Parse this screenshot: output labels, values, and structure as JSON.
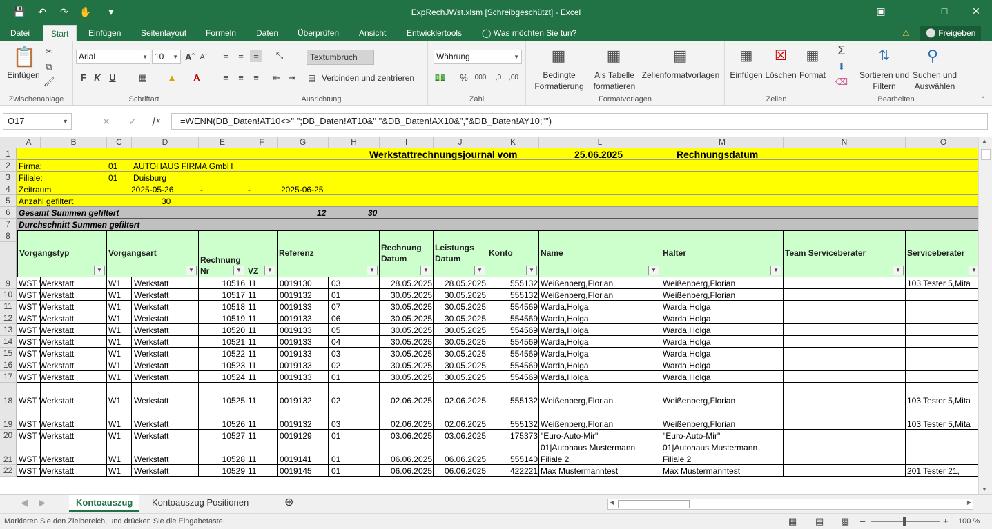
{
  "window": {
    "title": "ExpRechJWst.xlsm  [Schreibgeschützt] - Excel"
  },
  "ribbon_tabs": [
    "Datei",
    "Start",
    "Einfügen",
    "Seitenlayout",
    "Formeln",
    "Daten",
    "Überprüfen",
    "Ansicht",
    "Entwicklertools"
  ],
  "tell_me": "Was möchten Sie tun?",
  "share_label": "Freigeben",
  "ribbon": {
    "clipboard": {
      "paste": "Einfügen",
      "label": "Zwischenablage"
    },
    "font": {
      "name": "Arial",
      "size": "10",
      "label": "Schriftart",
      "bold": "F",
      "italic": "K",
      "underline": "U"
    },
    "align": {
      "wrap": "Textumbruch",
      "merge": "Verbinden und zentrieren",
      "label": "Ausrichtung"
    },
    "number": {
      "format": "Währung",
      "label": "Zahl"
    },
    "styles": {
      "cond1": "Bedingte",
      "cond2": "Formatierung",
      "table1": "Als Tabelle",
      "table2": "formatieren",
      "cell": "Zellenformatvorlagen",
      "label": "Formatvorlagen"
    },
    "cells": {
      "insert": "Einfügen",
      "delete": "Löschen",
      "format": "Format",
      "label": "Zellen"
    },
    "edit": {
      "sort1": "Sortieren und",
      "sort2": "Filtern",
      "find1": "Suchen und",
      "find2": "Auswählen",
      "label": "Bearbeiten"
    }
  },
  "formula_bar": {
    "name_box": "O17",
    "formula": "=WENN(DB_Daten!AT10<>\" \";DB_Daten!AT10&\" \"&DB_Daten!AX10&\",\"&DB_Daten!AY10;\"\")"
  },
  "columns": [
    "A",
    "B",
    "C",
    "D",
    "E",
    "F",
    "G",
    "H",
    "I",
    "J",
    "K",
    "L",
    "M",
    "N",
    "O"
  ],
  "sheet": {
    "row1": {
      "title": "Werkstattrechnungsjournal vom",
      "date": "25.06.2025",
      "label": "Rechnungsdatum"
    },
    "row2": {
      "label": "Firma:",
      "code": "01",
      "value": "AUTOHAUS FIRMA GmbH"
    },
    "row3": {
      "label": "Filiale:",
      "code": "01",
      "value": "Duisburg"
    },
    "row4": {
      "label": "Zeitraum",
      "from": "2025-05-26",
      "dash1": "-",
      "dash2": "-",
      "to": "2025-06-25"
    },
    "row5": {
      "label": "Anzahl gefiltert",
      "value": "30"
    },
    "row6": {
      "label": "Gesamt Summen gefiltert",
      "v1": "12",
      "v2": "30"
    },
    "row7": {
      "label": "Durchschnitt Summen gefiltert"
    },
    "headers": {
      "a": "Vorgangstyp",
      "c": "Vorgangsart",
      "e1": "Rechnung",
      "e2": "Nr",
      "f": "VZ",
      "g": "Referenz",
      "i1": "Rechnung",
      "i2": "Datum",
      "j1": "Leistungs",
      "j2": "Datum",
      "k": "Konto",
      "l": "Name",
      "m": "Halter",
      "n": "Team Serviceberater",
      "o": "Serviceberater"
    },
    "rows": [
      {
        "n": "9",
        "a": "WST Werkstatt",
        "c": "W1",
        "d": "Werkstatt",
        "e": "10516",
        "f": "11",
        "g": "0019130",
        "h": "03",
        "i": "28.05.2025",
        "j": "28.05.2025",
        "k": "555132",
        "l": "Weißenberg,Florian",
        "m": "Weißenberg,Florian",
        "o": "103 Tester 5,Mita"
      },
      {
        "n": "10",
        "a": "WST Werkstatt",
        "c": "W1",
        "d": "Werkstatt",
        "e": "10517",
        "f": "11",
        "g": "0019132",
        "h": "01",
        "i": "30.05.2025",
        "j": "30.05.2025",
        "k": "555132",
        "l": "Weißenberg,Florian",
        "m": "Weißenberg,Florian",
        "o": ""
      },
      {
        "n": "11",
        "a": "WST Werkstatt",
        "c": "W1",
        "d": "Werkstatt",
        "e": "10518",
        "f": "11",
        "g": "0019133",
        "h": "07",
        "i": "30.05.2025",
        "j": "30.05.2025",
        "k": "554569",
        "l": " Warda,Holga",
        "m": " Warda,Holga",
        "o": ""
      },
      {
        "n": "12",
        "a": "WST Werkstatt",
        "c": "W1",
        "d": "Werkstatt",
        "e": "10519",
        "f": "11",
        "g": "0019133",
        "h": "06",
        "i": "30.05.2025",
        "j": "30.05.2025",
        "k": "554569",
        "l": " Warda,Holga",
        "m": " Warda,Holga",
        "o": ""
      },
      {
        "n": "13",
        "a": "WST Werkstatt",
        "c": "W1",
        "d": "Werkstatt",
        "e": "10520",
        "f": "11",
        "g": "0019133",
        "h": "05",
        "i": "30.05.2025",
        "j": "30.05.2025",
        "k": "554569",
        "l": " Warda,Holga",
        "m": " Warda,Holga",
        "o": ""
      },
      {
        "n": "14",
        "a": "WST Werkstatt",
        "c": "W1",
        "d": "Werkstatt",
        "e": "10521",
        "f": "11",
        "g": "0019133",
        "h": "04",
        "i": "30.05.2025",
        "j": "30.05.2025",
        "k": "554569",
        "l": " Warda,Holga",
        "m": " Warda,Holga",
        "o": ""
      },
      {
        "n": "15",
        "a": "WST Werkstatt",
        "c": "W1",
        "d": "Werkstatt",
        "e": "10522",
        "f": "11",
        "g": "0019133",
        "h": "03",
        "i": "30.05.2025",
        "j": "30.05.2025",
        "k": "554569",
        "l": " Warda,Holga",
        "m": " Warda,Holga",
        "o": ""
      },
      {
        "n": "16",
        "a": "WST Werkstatt",
        "c": "W1",
        "d": "Werkstatt",
        "e": "10523",
        "f": "11",
        "g": "0019133",
        "h": "02",
        "i": "30.05.2025",
        "j": "30.05.2025",
        "k": "554569",
        "l": " Warda,Holga",
        "m": " Warda,Holga",
        "o": ""
      },
      {
        "n": "17",
        "a": "WST Werkstatt",
        "c": "W1",
        "d": "Werkstatt",
        "e": "10524",
        "f": "11",
        "g": "0019133",
        "h": "01",
        "i": "30.05.2025",
        "j": "30.05.2025",
        "k": "554569",
        "l": " Warda,Holga",
        "m": " Warda,Holga",
        "o": ""
      },
      {
        "n": "18",
        "a": "WST Werkstatt",
        "c": "W1",
        "d": "Werkstatt",
        "e": "10525",
        "f": "11",
        "g": "0019132",
        "h": "02",
        "i": "02.06.2025",
        "j": "02.06.2025",
        "k": "555132",
        "l": "Weißenberg,Florian",
        "m": "Weißenberg,Florian",
        "o": "103 Tester 5,Mita"
      },
      {
        "n": "19",
        "a": "WST Werkstatt",
        "c": "W1",
        "d": "Werkstatt",
        "e": "10526",
        "f": "11",
        "g": "0019132",
        "h": "03",
        "i": "02.06.2025",
        "j": "02.06.2025",
        "k": "555132",
        "l": "Weißenberg,Florian",
        "m": "Weißenberg,Florian",
        "o": "103 Tester 5,Mita"
      },
      {
        "n": "20",
        "a": "WST Werkstatt",
        "c": "W1",
        "d": "Werkstatt",
        "e": "10527",
        "f": "11",
        "g": "0019129",
        "h": "01",
        "i": "03.06.2025",
        "j": "03.06.2025",
        "k": "175373",
        "l": "\"Euro-Auto-Mir\"",
        "m": "\"Euro-Auto-Mir\"",
        "o": ""
      },
      {
        "n": "21",
        "a": "WST Werkstatt",
        "c": "W1",
        "d": "Werkstatt",
        "e": "10528",
        "f": "11",
        "g": "0019141",
        "h": "01",
        "i": "06.06.2025",
        "j": "06.06.2025",
        "k": "555140",
        "l": "01|Autohaus Mustermann",
        "l2": "Filiale 2",
        "m": "01|Autohaus Mustermann",
        "m2": "Filiale 2",
        "o": ""
      },
      {
        "n": "22",
        "a": "WST Werkstatt",
        "c": "W1",
        "d": "Werkstatt",
        "e": "10529",
        "f": "11",
        "g": "0019145",
        "h": "01",
        "i": "06.06.2025",
        "j": "06.06.2025",
        "k": "422221",
        "l": "Max Mustermanntest",
        "m": "Max Mustermanntest",
        "o": "201 Tester 21,"
      }
    ]
  },
  "sheet_tabs": [
    "Kontoauszug",
    "Kontoauszug Positionen"
  ],
  "status": {
    "text": "Markieren Sie den Zielbereich, und drücken Sie die Eingabetaste.",
    "zoom": "100 %"
  },
  "colors": {
    "excel_green": "#217346",
    "yellow": "#ffff00",
    "header_green": "#ccffcc",
    "summary_gray": "#c0c0c0"
  }
}
